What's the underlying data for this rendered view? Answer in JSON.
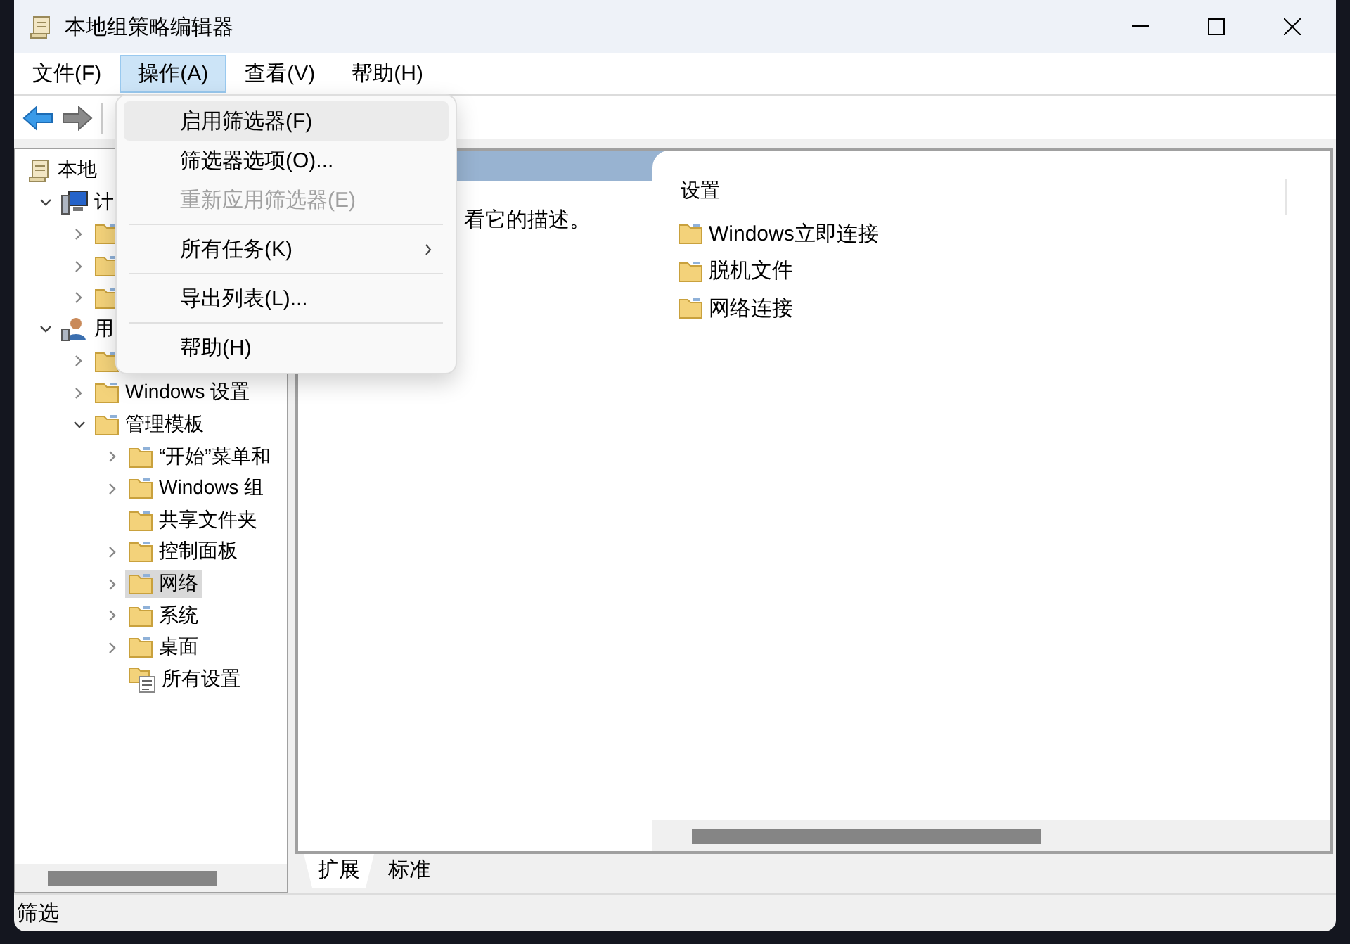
{
  "window": {
    "title": "本地组策略编辑器"
  },
  "menu_bar": [
    {
      "label": "文件(F)",
      "selected": false
    },
    {
      "label": "操作(A)",
      "selected": true
    },
    {
      "label": "查看(V)",
      "selected": false
    },
    {
      "label": "帮助(H)",
      "selected": false
    }
  ],
  "dropdown_menu": [
    {
      "kind": "item",
      "label": "启用筛选器(F)",
      "selected": true,
      "disabled": false,
      "submenu": false
    },
    {
      "kind": "item",
      "label": "筛选器选项(O)...",
      "selected": false,
      "disabled": false,
      "submenu": false
    },
    {
      "kind": "item",
      "label": "重新应用筛选器(E)",
      "selected": false,
      "disabled": true,
      "submenu": false
    },
    {
      "kind": "separator"
    },
    {
      "kind": "item",
      "label": "所有任务(K)",
      "selected": false,
      "disabled": false,
      "submenu": true
    },
    {
      "kind": "separator"
    },
    {
      "kind": "item",
      "label": "导出列表(L)...",
      "selected": false,
      "disabled": false,
      "submenu": false
    },
    {
      "kind": "separator"
    },
    {
      "kind": "item",
      "label": "帮助(H)",
      "selected": false,
      "disabled": false,
      "submenu": false
    }
  ],
  "tree": [
    {
      "label": "本地",
      "kind": "root",
      "selected": false,
      "children": [
        {
          "label": "计",
          "kind": "computer",
          "expanded": true,
          "selected": false,
          "children": [
            {
              "kind": "folder",
              "expanded": false,
              "selected": false
            },
            {
              "kind": "folder",
              "expanded": false,
              "selected": false
            },
            {
              "kind": "folder",
              "expanded": false,
              "selected": false
            }
          ]
        },
        {
          "label": "用",
          "kind": "user",
          "expanded": true,
          "selected": false,
          "children": [
            {
              "kind": "folder",
              "expanded": false,
              "selected": false
            },
            {
              "label": "Windows 设置",
              "kind": "folder",
              "expanded": false,
              "selected": false
            },
            {
              "label": "管理模板",
              "kind": "folder",
              "expanded": true,
              "selected": false,
              "children": [
                {
                  "label": "“开始”菜单和",
                  "kind": "folder",
                  "expanded": false,
                  "selected": false
                },
                {
                  "label": "Windows 组",
                  "kind": "folder",
                  "expanded": false,
                  "selected": false
                },
                {
                  "label": "共享文件夹",
                  "kind": "folder",
                  "selected": false
                },
                {
                  "label": "控制面板",
                  "kind": "folder",
                  "expanded": false,
                  "selected": false
                },
                {
                  "label": "网络",
                  "kind": "folder",
                  "expanded": false,
                  "selected": true
                },
                {
                  "label": "系统",
                  "kind": "folder",
                  "expanded": false,
                  "selected": false
                },
                {
                  "label": "桌面",
                  "kind": "folder",
                  "expanded": false,
                  "selected": false
                },
                {
                  "label": "所有设置",
                  "kind": "settings",
                  "selected": false
                }
              ]
            }
          ]
        }
      ]
    }
  ],
  "details": {
    "description": "看它的描述。",
    "column_header": "设置",
    "items": [
      "Windows立即连接",
      "脱机文件",
      "网络连接"
    ]
  },
  "view_tabs": [
    {
      "label": "扩展",
      "selected": true
    },
    {
      "label": "标准",
      "selected": false
    }
  ],
  "status_bar": "筛选"
}
